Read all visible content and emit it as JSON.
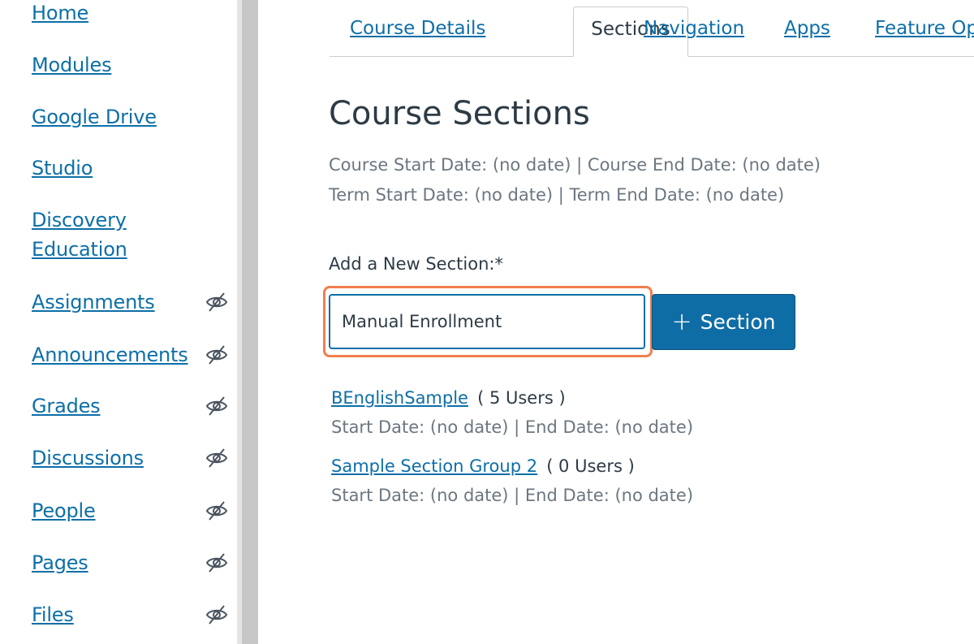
{
  "sidebar": {
    "items": [
      {
        "label": "Home",
        "hidden": false
      },
      {
        "label": "Modules",
        "hidden": false
      },
      {
        "label": "Google Drive",
        "hidden": false
      },
      {
        "label": "Studio",
        "hidden": false
      },
      {
        "label": "Discovery Education",
        "hidden": false
      },
      {
        "label": "Assignments",
        "hidden": true
      },
      {
        "label": "Announcements",
        "hidden": true
      },
      {
        "label": "Grades",
        "hidden": true
      },
      {
        "label": "Discussions",
        "hidden": true
      },
      {
        "label": "People",
        "hidden": true
      },
      {
        "label": "Pages",
        "hidden": true
      },
      {
        "label": "Files",
        "hidden": true
      }
    ],
    "hidden_icon": "eye-slash-icon"
  },
  "tabs": {
    "course_details": "Course Details",
    "sections": "Sections",
    "navigation": "Navigation",
    "apps": "Apps",
    "feature_options": "Feature Op"
  },
  "main": {
    "title": "Course Sections",
    "course_dates": "Course Start Date: (no date) | Course End Date: (no date)",
    "term_dates": "Term Start Date: (no date) | Term End Date: (no date)",
    "add_label": "Add a New Section:*",
    "input_value": "Manual Enrollment",
    "add_button_label": "Section",
    "add_button_icon": "plus-icon",
    "sections": [
      {
        "name": "BEnglishSample",
        "count": "( 5 Users )",
        "dates": "Start Date: (no date) | End Date: (no date)"
      },
      {
        "name": "Sample Section Group 2",
        "count": "( 0 Users )",
        "dates": "Start Date: (no date) | End Date: (no date)"
      }
    ]
  },
  "colors": {
    "link": "#0d6fa8",
    "text": "#2d3b45",
    "muted": "#6b7780",
    "button": "#0f6da6",
    "focus": "#f07f4f"
  }
}
